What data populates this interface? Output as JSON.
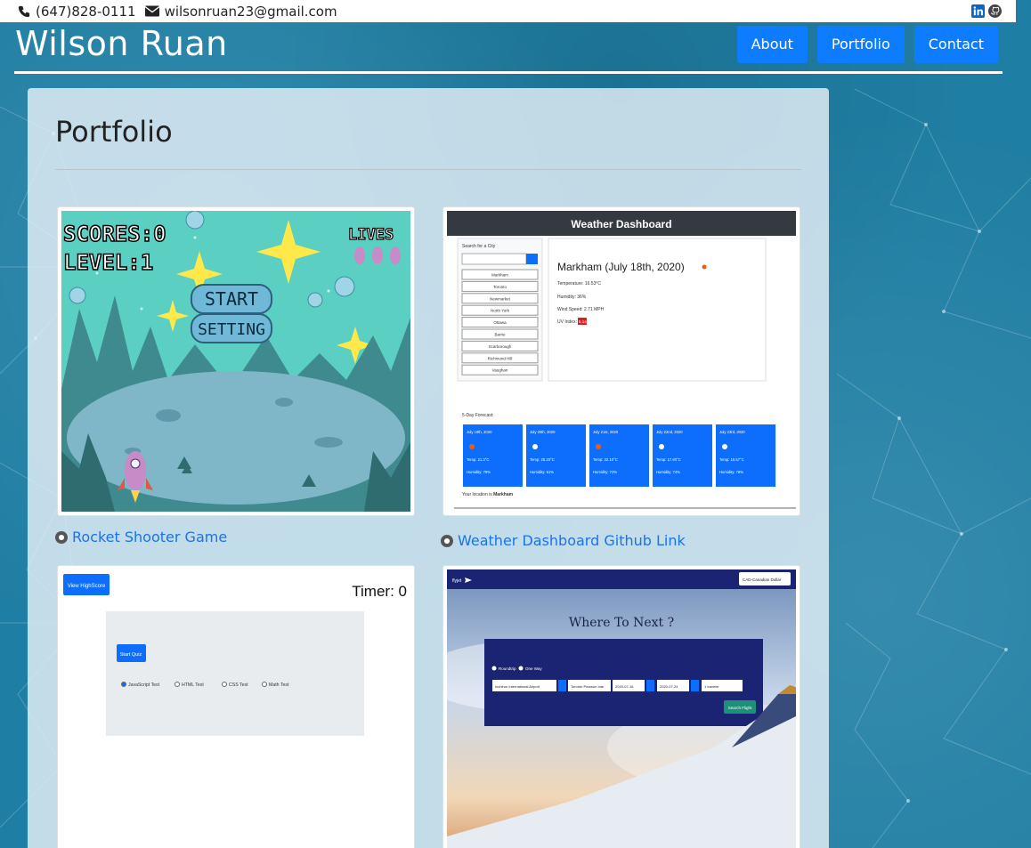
{
  "topbar": {
    "phone": "(647)828-0111",
    "email": "wilsonruan23@gmail.com",
    "icons": [
      "phone-icon",
      "envelope-icon",
      "linkedin-icon",
      "github-icon"
    ]
  },
  "header": {
    "brand": "Wilson Ruan",
    "nav": [
      {
        "label": "About"
      },
      {
        "label": "Portfolio"
      },
      {
        "label": "Contact"
      }
    ]
  },
  "portfolio": {
    "title": "Portfolio",
    "projects": [
      {
        "link_label": "Rocket Shooter Game",
        "screenshot": {
          "score": "SCORES:0",
          "level": "LEVEL:1",
          "lives": "LIVES",
          "start": "START",
          "setting": "SETTING"
        }
      },
      {
        "link_label": "Weather Dashboard Github Link",
        "screenshot": {
          "header": "Weather Dashboard",
          "search_label": "Search for a City",
          "cities": [
            "Markham",
            "Toronto",
            "Newmarket",
            "North York",
            "Ottawa",
            "Barrie",
            "Scarborough",
            "Richmond Hill",
            "Vaughan"
          ],
          "current_city": "Markham (July 18th, 2020)",
          "temperature": "Temperature: 16.53°C",
          "humidity": "Humidity: 36%",
          "wind": "Wind Speed: 2.71 MPH",
          "uv_label": "UV Index:",
          "uv_value": "5.14",
          "forecast_label": "5-Day Forecast:",
          "forecast": [
            {
              "date": "July 19th, 2020",
              "temp": "Temp: 21.3°C",
              "humidity": "Humidity: 79%"
            },
            {
              "date": "July 20th, 2020",
              "temp": "Temp: 25.20°C",
              "humidity": "Humidity: 61%"
            },
            {
              "date": "July 21st, 2020",
              "temp": "Temp: 22.10°C",
              "humidity": "Humidity: 72%"
            },
            {
              "date": "July 22nd, 2020",
              "temp": "Temp: 17.80°C",
              "humidity": "Humidity: 74%"
            },
            {
              "date": "July 23rd, 2020",
              "temp": "Temp: 19.57°C",
              "humidity": "Humidity: 78%"
            }
          ],
          "location_prefix": "Your location is",
          "location": "Markham"
        }
      },
      {
        "screenshot": {
          "highscore_button": "View HighScore",
          "timer": "Timer: 0",
          "start_button": "Start Quiz",
          "options": [
            "JavaScript Test",
            "HTML Test",
            "CSS Test",
            "Math Test"
          ]
        }
      },
      {
        "screenshot": {
          "logo": "flyjet",
          "currency": "CAD-Canadian Dollar",
          "headline": "Where To Next ?",
          "trip_types": [
            "Roundtrip",
            "One Way"
          ],
          "from": "Inchéon International Airport",
          "to": "Toronto Pearson Inte",
          "depart": "2020-07-16",
          "return": "2020-07-24",
          "travelers": "1 traveler",
          "search_button": "Search Flight"
        }
      }
    ]
  },
  "colors": {
    "background": "#1f7ea3",
    "nav_button": "#0d7cff",
    "link": "#1a73e8",
    "weather_tile": "#0d6efd",
    "uv_badge": "#e01b1b"
  }
}
